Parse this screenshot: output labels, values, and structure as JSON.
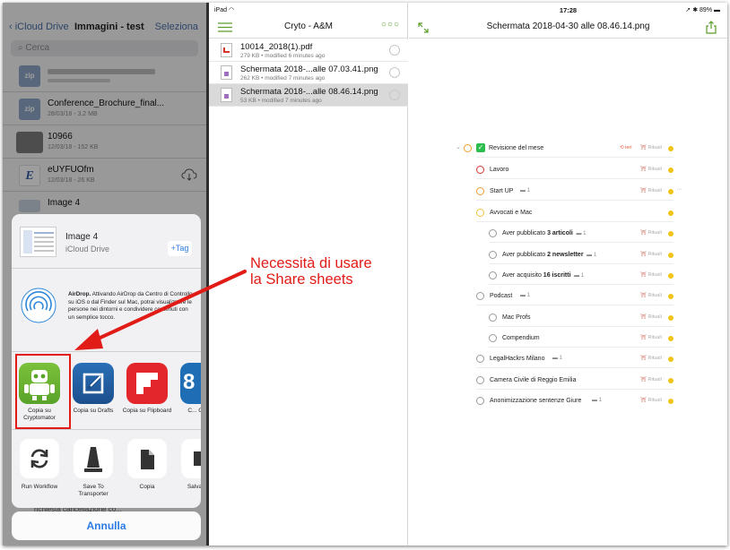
{
  "files_app": {
    "back_label": "iCloud Drive",
    "title": "Immagini - test",
    "select_label": "Seleziona",
    "search_placeholder": "Cerca",
    "files": [
      {
        "name": "",
        "meta": "",
        "icon": "zip"
      },
      {
        "name": "Conference_Brochure_final...",
        "meta": "28/03/18 - 3,2 MB",
        "icon": "zip"
      },
      {
        "name": "10966",
        "meta": "12/03/18 - 152 KB",
        "icon": "image"
      },
      {
        "name": "eUYFUOfm",
        "meta": "12/03/18 - 26 KB",
        "icon": "E"
      },
      {
        "name": "Image 4",
        "meta": "",
        "icon": "image"
      }
    ]
  },
  "share_sheet": {
    "item_title": "Image 4",
    "item_subtitle": "iCloud Drive",
    "tag_button": "+Tag",
    "airdrop_bold": "AirDrop.",
    "airdrop_text": " Attivando AirDrop da Centro di Controllo su iOS o dal Finder sul Mac, potrai visualizzare le persone nei dintorni e condividere contenuti con un semplice tocco.",
    "apps": [
      {
        "label": "Copia su Cryptomator",
        "icon": "cryptomator-icon"
      },
      {
        "label": "Copia su Drafts",
        "icon": "drafts-icon"
      },
      {
        "label": "Copia su Flipboard",
        "icon": "flipboard-icon"
      },
      {
        "label": "C... GoT...",
        "icon": "goodreader-icon"
      }
    ],
    "actions": [
      {
        "label": "Run Workflow",
        "icon": "workflow-icon"
      },
      {
        "label": "Save To Transporter",
        "icon": "transporter-icon"
      },
      {
        "label": "Copia",
        "icon": "copy-icon"
      },
      {
        "label": "Salva im...",
        "icon": "save-image-icon"
      }
    ],
    "cancel_label": "Annulla",
    "hidden_row_text": "richiesta cancellazione co..."
  },
  "status_bar": {
    "left": "iPad",
    "time": "17:28",
    "battery": "89%"
  },
  "middle_pane": {
    "title": "Cryto - A&M",
    "files": [
      {
        "name": "10014_2018(1).pdf",
        "meta": "279 KB • modified 6 minutes ago",
        "type": "pdf"
      },
      {
        "name": "Schermata 2018-...alle 07.03.41.png",
        "meta": "262 KB • modified 7 minutes ago",
        "type": "png"
      },
      {
        "name": "Schermata 2018-...alle 08.46.14.png",
        "meta": "53 KB • modified 7 minutes ago",
        "type": "png",
        "selected": true
      }
    ]
  },
  "right_pane": {
    "title": "Schermata 2018-04-30 alle 08.46.14.png",
    "tasks": [
      {
        "text": "Revisione del mese",
        "bold": "",
        "suffix": "",
        "badge": "ieri",
        "tag": "Rituali"
      },
      {
        "text": "Lavoro",
        "bold": "",
        "suffix": "",
        "tag": "Rituali"
      },
      {
        "text": "Start UP",
        "bold": "",
        "suffix": "1",
        "tag": "Rituali"
      },
      {
        "text": "Avvocati e Mac",
        "bold": "",
        "suffix": "",
        "tag": ""
      },
      {
        "text": "Aver pubblicato ",
        "bold": "3 articoli",
        "suffix": "1",
        "tag": "Rituali"
      },
      {
        "text": "Aver pubblicato ",
        "bold": "2 newsletter",
        "suffix": "1",
        "tag": "Rituali"
      },
      {
        "text": "Aver acquisito ",
        "bold": "16 iscritti",
        "suffix": "1",
        "tag": "Rituali"
      },
      {
        "text": "Podcast",
        "bold": "",
        "suffix": "1",
        "tag": "Rituali"
      },
      {
        "text": "Mac Profs",
        "bold": "",
        "suffix": "",
        "tag": "Rituali"
      },
      {
        "text": "Compendium",
        "bold": "",
        "suffix": "",
        "tag": "Rituali"
      },
      {
        "text": "LegalHackrs Milano",
        "bold": "",
        "suffix": "1",
        "tag": "Rituali"
      },
      {
        "text": "Camera Civile di Reggio Emilia",
        "bold": "",
        "suffix": "",
        "tag": "Rituali"
      },
      {
        "text": "Anonimizzazione sentenze Giure",
        "bold": "",
        "suffix": "1",
        "tag": "Rituali"
      }
    ]
  },
  "annotation": {
    "line1": "Necessità di usare",
    "line2": "la Share sheets"
  },
  "colors": {
    "accent_green": "#5a9e29",
    "annotation_red": "#e11b16",
    "ios_blue": "#2c7be5"
  }
}
